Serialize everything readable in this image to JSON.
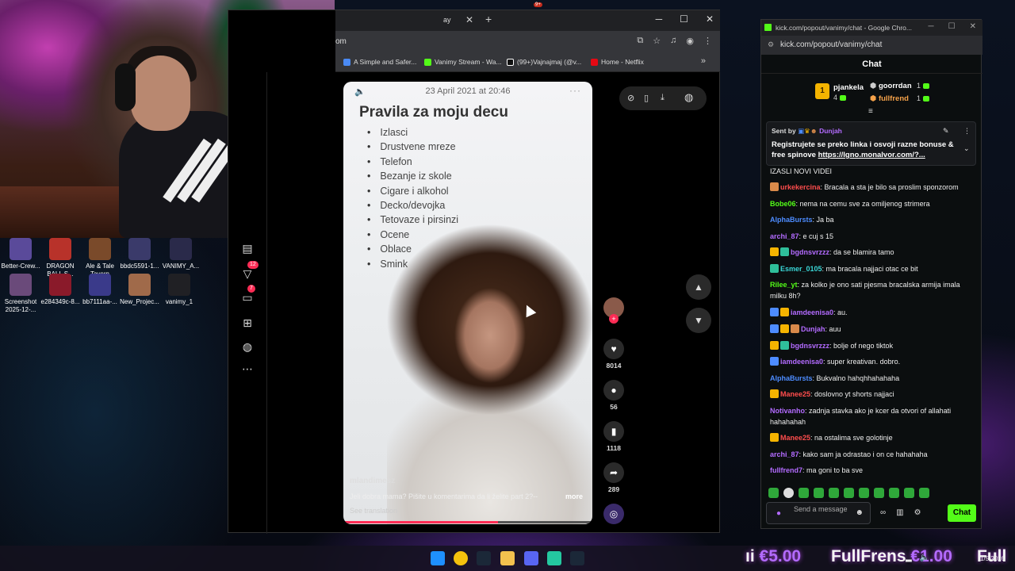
{
  "desktop": {
    "icons": [
      {
        "label": "Better-Crew...",
        "color": "#5a4a9a"
      },
      {
        "label": "DRAGON BALL S...",
        "color": "#b8322a"
      },
      {
        "label": "Ale & Tale Tavern",
        "color": "#7a4a2a"
      },
      {
        "label": "bbdc5591-1...",
        "color": "#3a3a6a"
      },
      {
        "label": "VANIMY_A...",
        "color": "#2a2a4a"
      },
      {
        "label": "Screenshot 2025-12-...",
        "color": "#6a4a7a"
      },
      {
        "label": "e284349c-8...",
        "color": "#8a1a2a"
      },
      {
        "label": "bb7111aa-...",
        "color": "#3a3a8a"
      },
      {
        "label": "New_Projec...",
        "color": "#a06a4a"
      },
      {
        "label": "vanimy_1",
        "color": "#202024"
      }
    ]
  },
  "browser": {
    "tab_fragment": "ay",
    "url_fragment": "om",
    "bookmarks": [
      {
        "label": "A Simple and Safer...",
        "color": "#4a8af4"
      },
      {
        "label": "Vanimy Stream - Wa...",
        "color": "#53fc18"
      },
      {
        "label": "(99+)Vajnajmaj (@v...",
        "color": "#111111"
      },
      {
        "label": "Home - Netflix",
        "color": "#e50914"
      }
    ]
  },
  "tiktok": {
    "sidebar_badges": {
      "activity": "12",
      "messages": "7"
    },
    "video": {
      "date": "23 April 2021 at 20:46",
      "title": "Pravila za moju decu",
      "list": [
        "Izlasci",
        "Drustvene mreze",
        "Telefon",
        "Bezanje iz skole",
        "Cigare i alkohol",
        "Decko/devojka",
        "Tetovaze i pirsinzi",
        "Ocene",
        "Oblace",
        "Smink"
      ],
      "username": "mlandimesz",
      "caption": "Jeli dobra mama? Pišite u komentarima da li želite part 2?--",
      "more": "more",
      "translate": "See translation",
      "progress": 0.62
    },
    "actions": {
      "likes": "8014",
      "comments": "56",
      "saves": "1118",
      "shares": "289"
    }
  },
  "chat": {
    "window_title": "kick.com/popout/vanimy/chat - Google Chro...",
    "url": "kick.com/popout/vanimy/chat",
    "header": "Chat",
    "leaderboard": {
      "first": {
        "rank": "1",
        "name": "pjankela",
        "count": "4"
      },
      "second": {
        "name": "goorrdan",
        "count": "1"
      },
      "third": {
        "name": "fullfrend",
        "count": "1"
      }
    },
    "pinned": {
      "sent_by_label": "Sent by",
      "user": "Dunjah",
      "text": "Registrujete se preko linka i osvoji razne bonuse & free spinove",
      "link": "https://lgno.monalvor.com/?..."
    },
    "messages": [
      {
        "user": "",
        "color": "#ffffff",
        "text": "IZASLI NOVI VIDEI"
      },
      {
        "user": "urkekercina",
        "color": "#ff4d4d",
        "text": ": Bracala a sta je bilo sa proslim sponzorom"
      },
      {
        "user": "Bobe06",
        "color": "#53fc18",
        "text": ": nema na cemu sve za omiljenog strimera"
      },
      {
        "user": "AlphaBursts",
        "color": "#4d8cff",
        "text": ": Ja ba"
      },
      {
        "user": "archi_87",
        "color": "#b36bff",
        "text": ": e cuj s 15"
      },
      {
        "user": "bgdnsvrzzz",
        "color": "#b36bff",
        "text": ": da se blamira tamo"
      },
      {
        "user": "Esmer_0105",
        "color": "#3ad6d6",
        "text": ": ma bracala najjaci otac ce bit"
      },
      {
        "user": "Rilee_yt",
        "color": "#53fc18",
        "text": ": za kolko je ono sati pjesma bracalska armija imala milku 8h?"
      },
      {
        "user": "iamdeenisa0",
        "color": "#b36bff",
        "text": ": au."
      },
      {
        "user": "Dunjah",
        "color": "#b36bff",
        "text": ": auu"
      },
      {
        "user": "bgdnsvrzzz",
        "color": "#b36bff",
        "text": ": bolje of nego tiktok"
      },
      {
        "user": "iamdeenisa0",
        "color": "#b36bff",
        "text": ": super kreativan. dobro."
      },
      {
        "user": "AlphaBursts",
        "color": "#4d8cff",
        "text": ": Bukvalno hahqhhahahaha"
      },
      {
        "user": "Manee25",
        "color": "#ff4d4d",
        "text": ": doslovno yt shorts najjaci"
      },
      {
        "user": "Notivanho",
        "color": "#b36bff",
        "text": ": zadnja stavka ako je kcer da otvori of allahati hahahahah"
      },
      {
        "user": "Manee25",
        "color": "#ff4d4d",
        "text": ": na ostalima sve golotinje"
      },
      {
        "user": "archi_87",
        "color": "#b36bff",
        "text": ": kako sam ja odrastao i on ce hahahaha"
      },
      {
        "user": "fullfrend7",
        "color": "#b36bff",
        "text": ": ma goni to ba sve"
      }
    ],
    "input_placeholder": "Send a message",
    "send_label": "Chat"
  },
  "overlay": {
    "money1": "€5.00",
    "name": "FullFrens",
    "money2": "€1.00",
    "name_partial": "Full"
  },
  "clock": {
    "date": "1/5/2026"
  }
}
